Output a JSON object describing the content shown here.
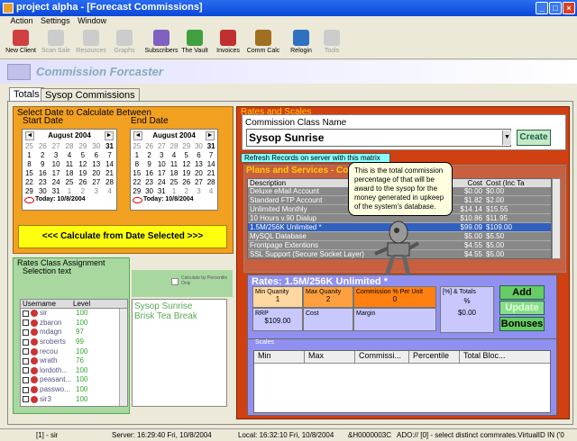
{
  "window": {
    "title": "project alpha - [Forecast Commissions]"
  },
  "menu": [
    "Action",
    "Settings",
    "Window"
  ],
  "toolbar": [
    {
      "label": "New Client",
      "enabled": true,
      "icon": "new-client-icon",
      "color": "#d04040"
    },
    {
      "label": "Scan Sale",
      "enabled": false,
      "icon": "scan-icon",
      "color": "#ccc"
    },
    {
      "label": "Resources",
      "enabled": false,
      "icon": "resources-icon",
      "color": "#ccc"
    },
    {
      "label": "Graphs",
      "enabled": false,
      "icon": "graphs-icon",
      "color": "#ccc"
    },
    {
      "label": "Subscribers",
      "enabled": true,
      "icon": "subscribers-icon",
      "color": "#8060c0"
    },
    {
      "label": "The Vault",
      "enabled": true,
      "icon": "vault-icon",
      "color": "#40a040"
    },
    {
      "label": "Invoices",
      "enabled": true,
      "icon": "invoices-icon",
      "color": "#c03030"
    },
    {
      "label": "Comm Calc",
      "enabled": true,
      "icon": "money-bag-icon",
      "color": "#a07020"
    },
    {
      "label": "Relogin",
      "enabled": true,
      "icon": "relogin-icon",
      "color": "#3070c0"
    },
    {
      "label": "Tools",
      "enabled": false,
      "icon": "tools-icon",
      "color": "#ccc"
    }
  ],
  "header": {
    "title": "Commission Forcaster"
  },
  "tabs": [
    "Totals",
    "Sysop Commissions"
  ],
  "date_section": {
    "title": "Select Date to Calculate Between",
    "start_label": "Start Date",
    "end_label": "End Date"
  },
  "calendar": {
    "month": "August 2004",
    "today": "Today: 10/8/2004",
    "days": [
      "25",
      "26",
      "27",
      "28",
      "29",
      "30",
      "31",
      "1",
      "2",
      "3",
      "4",
      "5",
      "6",
      "7",
      "8",
      "9",
      "10",
      "11",
      "12",
      "13",
      "14",
      "15",
      "16",
      "17",
      "18",
      "19",
      "20",
      "21",
      "22",
      "23",
      "24",
      "25",
      "26",
      "27",
      "28",
      "29",
      "30",
      "31",
      "1",
      "2",
      "3",
      "4"
    ]
  },
  "calc_button": "<<< Calculate from Date Selected >>>",
  "rates_assign": {
    "title": "Rates Class Assignment",
    "selection": "Selection text",
    "check_label": "Calculate by Percentile Only",
    "col_user": "Username",
    "col_level": "Level",
    "users": [
      {
        "name": "sir",
        "level": "100"
      },
      {
        "name": "zbaron",
        "level": "100"
      },
      {
        "name": "mdagn",
        "level": "97"
      },
      {
        "name": "sroberts",
        "level": "99"
      },
      {
        "name": "recou",
        "level": "100"
      },
      {
        "name": "wrath",
        "level": "76"
      },
      {
        "name": "lordoth...",
        "level": "100"
      },
      {
        "name": "peasant...",
        "level": "100"
      },
      {
        "name": "passwo...",
        "level": "100"
      },
      {
        "name": "sir3",
        "level": "100"
      }
    ],
    "classes": [
      "Sysop Sunrise",
      "Brisk Tea Break"
    ]
  },
  "rates_scales": {
    "title": "Rates and Scales",
    "class_label": "Commission Class Name",
    "class_value": "Sysop Sunrise",
    "create": "Create",
    "refresh": "Refresh Records on server with this matrix"
  },
  "plans": {
    "title": "Plans and Services - Co",
    "cols": [
      "Description",
      "Cost",
      "Cost (Inc Ta"
    ],
    "rows": [
      [
        "Deluxe eMail Account",
        "$0.00",
        "$0.00"
      ],
      [
        "Standard FTP Account",
        "$1.82",
        "$2.00"
      ],
      [
        "Unlimited Monthly",
        "$14.14",
        "$15.55"
      ],
      [
        "10 Hours v.90 Dialup",
        "$10.86",
        "$11.95"
      ],
      [
        "1.5M/256K Unlimited *",
        "$99.09",
        "$109.00"
      ],
      [
        "MySQL Database",
        "$5.00",
        "$5.50"
      ],
      [
        "Frontpage Extentions",
        "$4.55",
        "$5.00"
      ],
      [
        "SSL Support (Secure Socket Layer)",
        "$4.55",
        "$5.00"
      ]
    ]
  },
  "tooltip": "This is the total commission percentage of that will be award to the sysop for the money generated in upkeep of the system's database.",
  "rates": {
    "title": "Rates: 1.5M/256K Unlimited *",
    "min_q": "Min Quanity",
    "min_q_val": "1",
    "max_q": "Max Quanity",
    "max_q_val": "2",
    "comm": "Commission % Per Unit",
    "comm_val": "0",
    "pct": "[%] & Totals",
    "pct_sym": "%",
    "pct_total": "$0.00",
    "rrp": "RRP",
    "rrp_val": "$109.00",
    "cost": "Cost",
    "margin": "Margin",
    "add": "Add",
    "update": "Update",
    "bonuses": "Bonuses"
  },
  "scales": {
    "title": "Scales",
    "cols": [
      "Min",
      "Max",
      "Commissi...",
      "Percentile",
      "Total Bloc..."
    ]
  },
  "status": [
    "[1] - sir",
    "Server: 16:29:40 Fri, 10/8/2004",
    "Local: 16:32:10 Fri, 10/8/2004",
    "&H0000003C",
    "ADO:// [0] - select distinct commrates.VirtualID IN ('0"
  ]
}
